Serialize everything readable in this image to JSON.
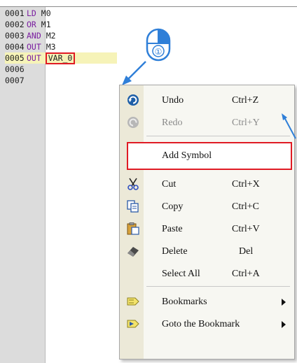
{
  "editor": {
    "lines": [
      {
        "num": "0001",
        "kw": "LD",
        "arg": "M0"
      },
      {
        "num": "0002",
        "kw": "OR",
        "arg": "M1"
      },
      {
        "num": "0003",
        "kw": "AND",
        "arg": "M2"
      },
      {
        "num": "0004",
        "kw": "OUT",
        "arg": "M3"
      },
      {
        "num": "0005",
        "kw": "OUT",
        "arg": "VAR_0"
      },
      {
        "num": "0006",
        "kw": "",
        "arg": ""
      },
      {
        "num": "0007",
        "kw": "",
        "arg": ""
      }
    ]
  },
  "callout": {
    "number": "①"
  },
  "context_menu": {
    "items": [
      {
        "label": "Undo",
        "shortcut": "Ctrl+Z",
        "icon": "undo-icon",
        "enabled": true
      },
      {
        "label": "Redo",
        "shortcut": "Ctrl+Y",
        "icon": "redo-icon",
        "enabled": false
      },
      {
        "label": "Add Symbol",
        "shortcut": "",
        "icon": "",
        "enabled": true
      },
      {
        "label": "Cut",
        "shortcut": "Ctrl+X",
        "icon": "scissors-icon",
        "enabled": true
      },
      {
        "label": "Copy",
        "shortcut": "Ctrl+C",
        "icon": "copy-icon",
        "enabled": true
      },
      {
        "label": "Paste",
        "shortcut": "Ctrl+V",
        "icon": "paste-icon",
        "enabled": true
      },
      {
        "label": "Delete",
        "shortcut": "Del",
        "icon": "eraser-icon",
        "enabled": true
      },
      {
        "label": "Select All",
        "shortcut": "Ctrl+A",
        "icon": "",
        "enabled": true
      },
      {
        "label": "Bookmarks",
        "shortcut": "",
        "icon": "bookmark-icon",
        "enabled": true
      },
      {
        "label": "Goto the Bookmark",
        "shortcut": "",
        "icon": "goto-bookmark-icon",
        "enabled": true
      }
    ]
  },
  "colors": {
    "highlight_red": "#e01b24",
    "accent_blue": "#2f7fd8",
    "keyword_purple": "#7a1ea0"
  }
}
